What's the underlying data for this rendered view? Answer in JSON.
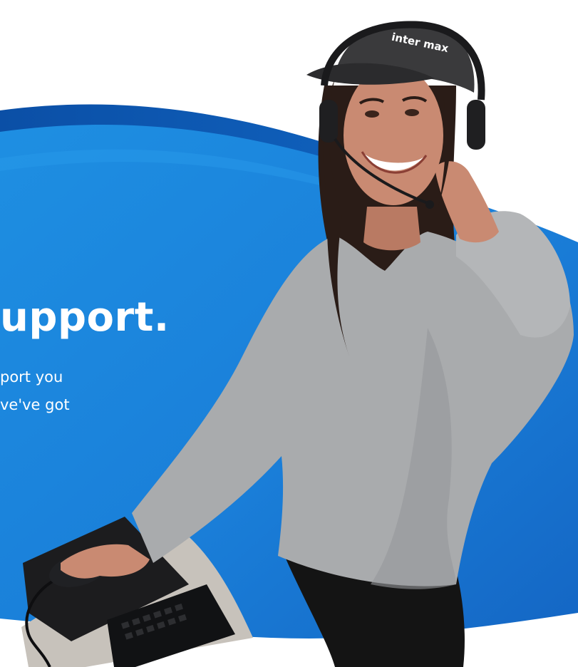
{
  "hero": {
    "headline": "upport.",
    "body_lines": [
      "port you",
      "ve've got"
    ],
    "cap_logo_text": "inter max"
  },
  "colors": {
    "wave_light": "#1e90e4",
    "wave_mid": "#1673cf",
    "wave_dark": "#0c4ea8",
    "text": "#ffffff",
    "sweater": "#a9abad",
    "hair": "#2a1c17",
    "cap": "#3a3a3c",
    "skin": "#c98a72",
    "desk": "#c7c2bb",
    "mousepad": "#1c1c1e"
  },
  "icons": {
    "headset": "headset-icon",
    "mouse": "computer-mouse-icon",
    "keyboard": "keyboard-icon"
  }
}
